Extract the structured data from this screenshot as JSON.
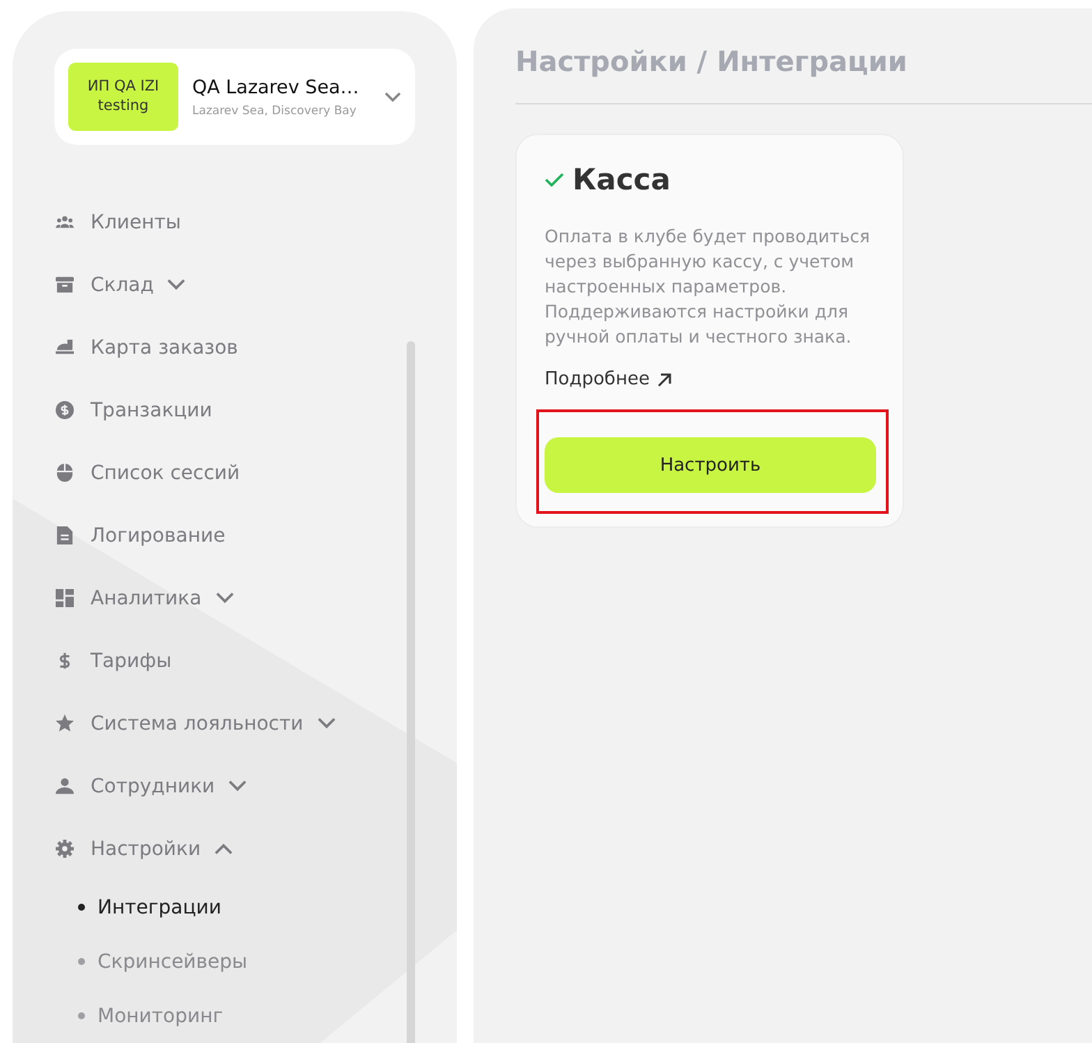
{
  "sidebar": {
    "org": {
      "badge": "ИП QA IZI testing",
      "name": "QA Lazarev Sea…",
      "address": "Lazarev Sea, Discovery Bay"
    },
    "items": [
      {
        "label": "Клиенты"
      },
      {
        "label": "Склад",
        "expanded": false
      },
      {
        "label": "Карта заказов"
      },
      {
        "label": "Транзакции"
      },
      {
        "label": "Список сессий"
      },
      {
        "label": "Логирование"
      },
      {
        "label": "Аналитика",
        "expanded": false
      },
      {
        "label": "Тарифы"
      },
      {
        "label": "Система лояльности",
        "expanded": false
      },
      {
        "label": "Сотрудники",
        "expanded": false
      },
      {
        "label": "Настройки",
        "expanded": true,
        "children": [
          {
            "label": "Интеграции",
            "selected": true
          },
          {
            "label": "Скринсейверы",
            "selected": false
          },
          {
            "label": "Мониторинг",
            "selected": false
          }
        ]
      }
    ]
  },
  "main": {
    "breadcrumb": "Настройки / Интеграции",
    "card": {
      "title": "Касса",
      "connected": true,
      "description": "Оплата в клубе будет проводиться через выбранную кассу, с учетом настроенных параметров. Поддерживаются настройки для ручной оплаты и честного знака.",
      "link": "Подробнее",
      "button": "Настроить",
      "highlighted": true
    }
  }
}
